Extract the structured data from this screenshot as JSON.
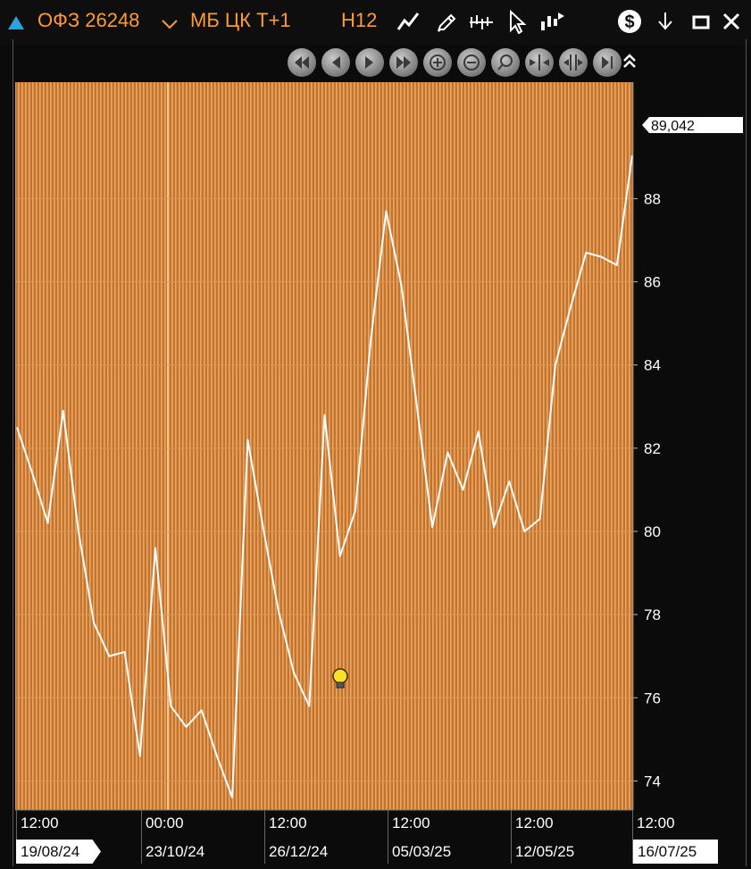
{
  "toolbar": {
    "instrument": "ОФЗ 26248",
    "market": "МБ ЦК Т+1",
    "timeframe": "H12",
    "accent": "#ff9b30",
    "icons": [
      "triangle-up-icon",
      "chevron-down-icon",
      "line-chart-icon",
      "pencil-icon",
      "bars-icon",
      "cursor-icon",
      "indicator-icon",
      "dollar-icon",
      "arrow-down-icon",
      "minimize-icon",
      "close-icon"
    ]
  },
  "navigation": {
    "buttons": [
      "scroll-left-fast",
      "scroll-left",
      "scroll-right",
      "scroll-right-fast",
      "zoom-in",
      "zoom-out",
      "zoom-fit",
      "compress",
      "expand",
      "scroll-end",
      "collapse"
    ]
  },
  "price_label": "89,042",
  "x_axis": {
    "times": [
      "12:00",
      "00:00",
      "12:00",
      "12:00",
      "12:00",
      "12:00"
    ],
    "dates": [
      "19/08/24",
      "23/10/24",
      "26/12/24",
      "05/03/25",
      "12/05/25",
      "16/07/25"
    ]
  },
  "chart_data": {
    "type": "line",
    "y_ticks": [
      74,
      76,
      78,
      80,
      82,
      84,
      86,
      88
    ],
    "ylim": [
      73.3,
      90.8
    ],
    "background": "#c27530",
    "line_color": "#ffffff",
    "last_value": 89.042,
    "x": [
      "19/08/24",
      "28/08/24",
      "06/09/24",
      "13/09/24",
      "24/09/24",
      "08/10/24",
      "17/10/24",
      "23/10/24",
      "29/10/24",
      "07/11/24",
      "19/11/24",
      "27/11/24",
      "04/12/24",
      "10/12/24",
      "16/12/24",
      "26/12/24",
      "10/01/25",
      "23/01/25",
      "30/01/25",
      "04/02/25",
      "11/02/25",
      "21/02/25",
      "05/03/25",
      "17/03/25",
      "25/03/25",
      "29/03/25",
      "07/04/25",
      "14/04/25",
      "21/04/25",
      "29/04/25",
      "05/05/25",
      "12/05/25",
      "21/05/25",
      "29/05/25",
      "09/06/25",
      "18/06/25",
      "26/06/25",
      "01/07/25",
      "08/07/25",
      "14/07/25",
      "16/07/25"
    ],
    "values": [
      82.5,
      81.4,
      80.2,
      82.9,
      80.0,
      77.8,
      77.0,
      77.1,
      74.6,
      79.6,
      75.8,
      75.3,
      75.7,
      74.6,
      73.6,
      82.2,
      80.1,
      78.1,
      76.6,
      75.8,
      82.8,
      79.4,
      80.5,
      84.6,
      87.7,
      85.9,
      83.0,
      80.1,
      81.9,
      81.0,
      82.4,
      80.1,
      81.2,
      80.0,
      80.3,
      84.0,
      85.4,
      86.7,
      86.6,
      86.4,
      89.04
    ]
  },
  "colors": {
    "background": "#0b0b0b",
    "plot": "#c27530",
    "line": "#ffffff",
    "axis_text": "#ffffff"
  }
}
